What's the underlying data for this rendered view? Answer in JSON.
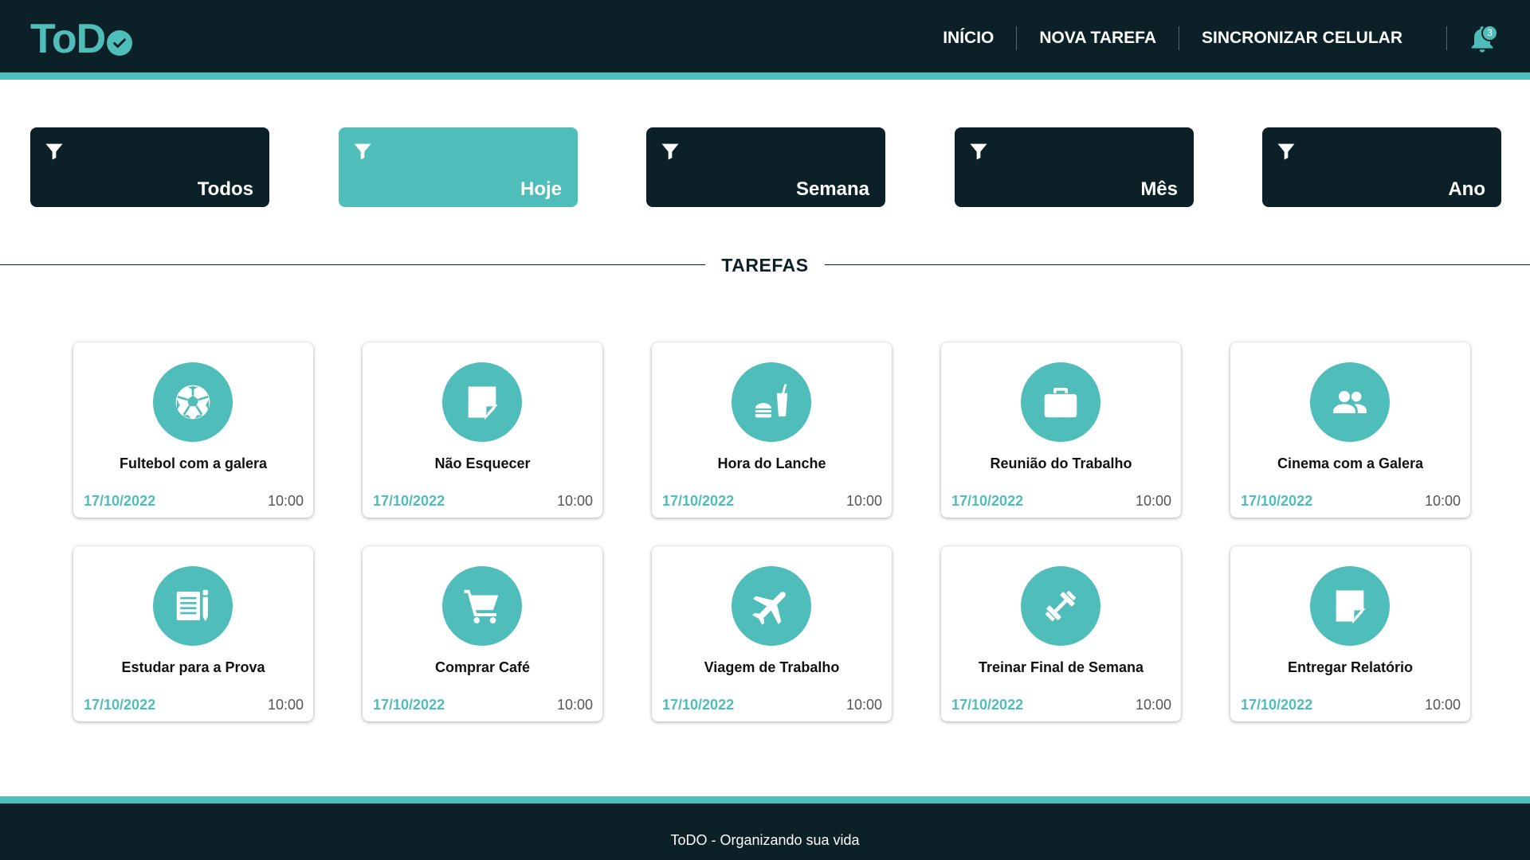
{
  "app": {
    "logo_text": "ToD",
    "logo_icon": "check-circle-icon",
    "accent_color": "#4fbdba",
    "dark_color": "#0b2127"
  },
  "nav": {
    "items": [
      {
        "label": "INÍCIO"
      },
      {
        "label": "NOVA TAREFA"
      },
      {
        "label": "SINCRONIZAR CELULAR"
      }
    ],
    "notifications_count": "3",
    "notifications_icon": "bell-icon"
  },
  "filters": {
    "icon": "filter-icon",
    "items": [
      {
        "label": "Todos",
        "active": false
      },
      {
        "label": "Hoje",
        "active": true
      },
      {
        "label": "Semana",
        "active": false
      },
      {
        "label": "Mês",
        "active": false
      },
      {
        "label": "Ano",
        "active": false
      }
    ]
  },
  "section": {
    "title": "TAREFAS"
  },
  "tasks": [
    {
      "title": "Fultebol com a galera",
      "date": "17/10/2022",
      "time": "10:00",
      "icon": "soccer-ball-icon"
    },
    {
      "title": "Não Esquecer",
      "date": "17/10/2022",
      "time": "10:00",
      "icon": "sticky-note-icon"
    },
    {
      "title": "Hora do Lanche",
      "date": "17/10/2022",
      "time": "10:00",
      "icon": "fastfood-icon"
    },
    {
      "title": "Reunião do Trabalho",
      "date": "17/10/2022",
      "time": "10:00",
      "icon": "briefcase-icon"
    },
    {
      "title": "Cinema com a Galera",
      "date": "17/10/2022",
      "time": "10:00",
      "icon": "group-icon"
    },
    {
      "title": "Estudar para a Prova",
      "date": "17/10/2022",
      "time": "10:00",
      "icon": "notes-pencil-icon"
    },
    {
      "title": "Comprar Café",
      "date": "17/10/2022",
      "time": "10:00",
      "icon": "shopping-cart-icon"
    },
    {
      "title": "Viagem de Trabalho",
      "date": "17/10/2022",
      "time": "10:00",
      "icon": "airplane-icon"
    },
    {
      "title": "Treinar Final de Semana",
      "date": "17/10/2022",
      "time": "10:00",
      "icon": "dumbbell-icon"
    },
    {
      "title": "Entregar Relatório",
      "date": "17/10/2022",
      "time": "10:00",
      "icon": "sticky-note-icon"
    }
  ],
  "footer": {
    "text": "ToDO - Organizando sua vida"
  }
}
